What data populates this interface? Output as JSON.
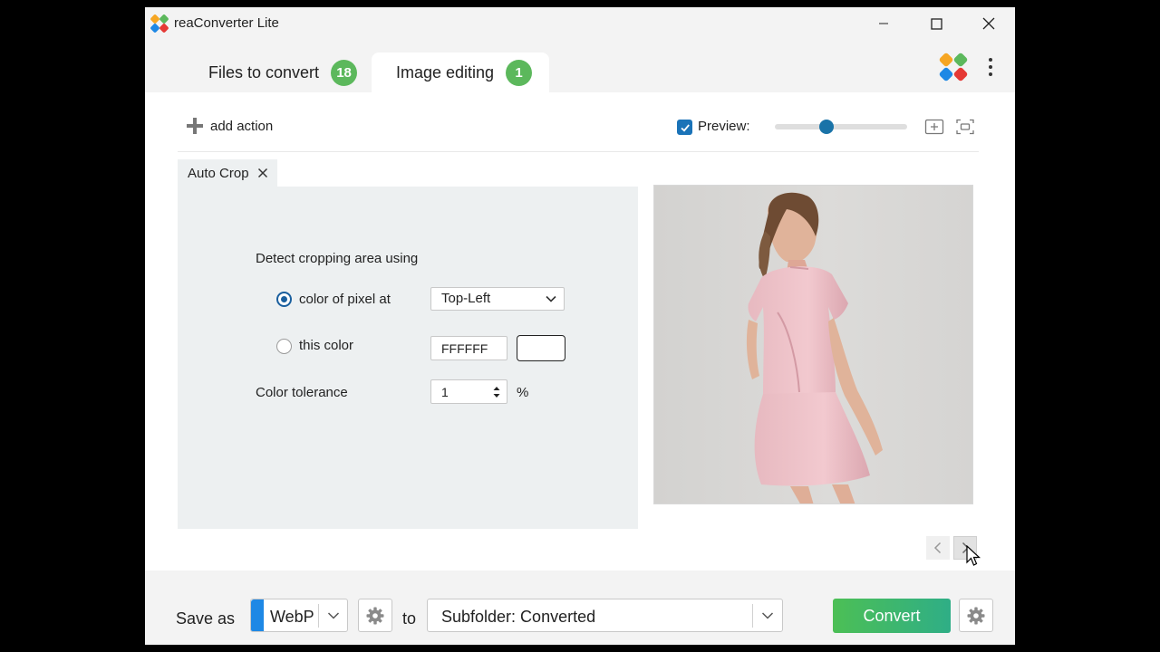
{
  "window": {
    "title": "reaConverter Lite"
  },
  "tabs": [
    {
      "label": "Files to convert",
      "badge": "18"
    },
    {
      "label": "Image editing",
      "badge": "1"
    }
  ],
  "toolbar": {
    "add_action_label": "add action",
    "preview_label": "Preview:",
    "preview_checked": true,
    "zoom_level": 0.39
  },
  "action": {
    "tab_label": "Auto Crop",
    "detect_label": "Detect cropping area using",
    "option_pixel_label": "color of pixel at",
    "pixel_position_value": "Top-Left",
    "option_color_label": "this color",
    "color_value": "FFFFFF",
    "tolerance_label": "Color tolerance",
    "tolerance_value": "1",
    "tolerance_unit": "%"
  },
  "footer": {
    "save_as_label": "Save as",
    "format_value": "WebP",
    "to_label": "to",
    "destination_value": "Subfolder: Converted",
    "convert_label": "Convert"
  },
  "colors": {
    "accent_green": "#5cb85c",
    "accent_blue": "#1a73b8",
    "convert_start": "#4cbf55",
    "convert_end": "#2fae86",
    "swatch_color": "#FFFFFF"
  }
}
